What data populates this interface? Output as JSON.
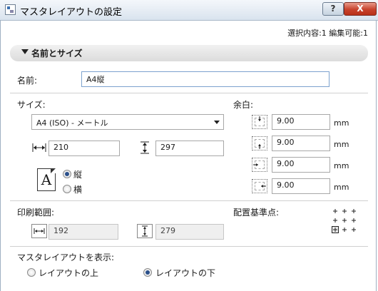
{
  "window": {
    "title": "マスタレイアウトの設定",
    "help_label": "?",
    "close_label": "X"
  },
  "selection_info": "選択内容:1 編集可能:1",
  "section": {
    "title": "名前とサイズ"
  },
  "name": {
    "label": "名前:",
    "value": "A4縦"
  },
  "size": {
    "label": "サイズ:",
    "selected": "A4 (ISO) - メートル",
    "width": "210",
    "height": "297",
    "orientation": {
      "portrait": "縦",
      "landscape": "横",
      "selected": "portrait",
      "paper_glyph": "A"
    }
  },
  "margins": {
    "label": "余白:",
    "unit": "mm",
    "top": "9.00",
    "bottom": "9.00",
    "left": "9.00",
    "right": "9.00"
  },
  "print_area": {
    "label": "印刷範囲:",
    "width": "192",
    "height": "279"
  },
  "anchor": {
    "label": "配置基準点:",
    "selected": "bottom-left"
  },
  "show_master": {
    "label": "マスタレイアウトを表示:",
    "options": [
      "レイアウトの上",
      "レイアウトの下"
    ],
    "selected": "レイアウトの下"
  }
}
